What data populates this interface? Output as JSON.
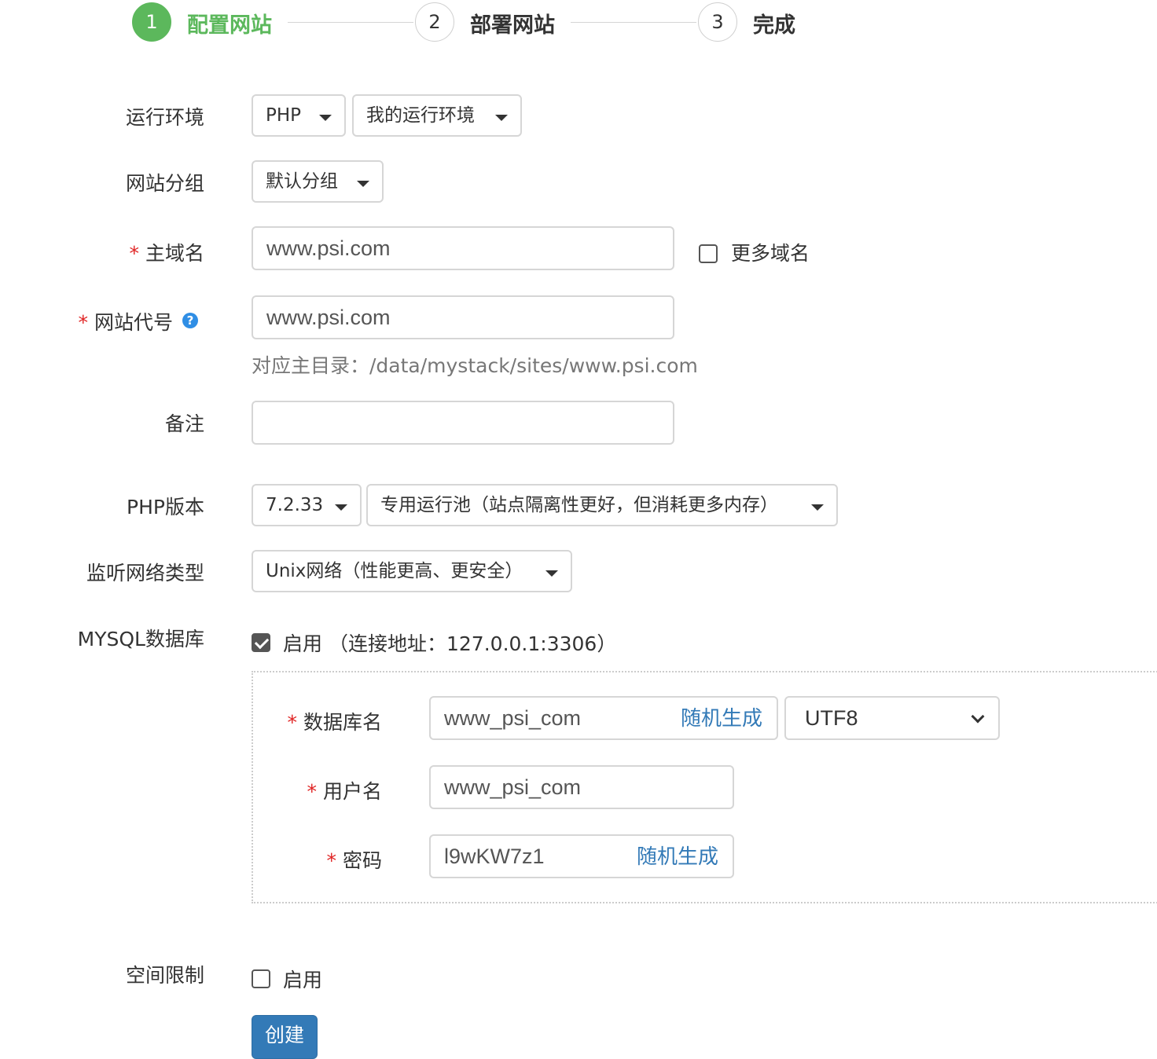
{
  "steps": [
    {
      "number": "1",
      "label": "配置网站",
      "active": true
    },
    {
      "number": "2",
      "label": "部署网站",
      "active": false
    },
    {
      "number": "3",
      "label": "完成",
      "active": false
    }
  ],
  "form": {
    "runtime": {
      "label": "运行环境",
      "type_value": "PHP",
      "env_value": "我的运行环境"
    },
    "group": {
      "label": "网站分组",
      "value": "默认分组"
    },
    "domain": {
      "required": "*",
      "label": "主域名",
      "value": "www.psi.com",
      "more_label": "更多域名",
      "more_checked": false
    },
    "site_code": {
      "required": "*",
      "label": "网站代号",
      "help_icon": "?",
      "value": "www.psi.com",
      "hint": "对应主目录：/data/mystack/sites/www.psi.com"
    },
    "remark": {
      "label": "备注",
      "value": ""
    },
    "php": {
      "label": "PHP版本",
      "version": "7.2.33",
      "pool": "专用运行池（站点隔离性更好，但消耗更多内存）"
    },
    "listen": {
      "label": "监听网络类型",
      "value": "Unix网络（性能更高、更安全）"
    },
    "mysql": {
      "label": "MYSQL数据库",
      "enabled_label": "启用",
      "enabled": true,
      "address": "（连接地址：127.0.0.1:3306）",
      "db_name": {
        "required": "*",
        "label": "数据库名",
        "value": "www_psi_com",
        "generate": "随机生成",
        "charset": "UTF8"
      },
      "username": {
        "required": "*",
        "label": "用户名",
        "value": "www_psi_com"
      },
      "password": {
        "required": "*",
        "label": "密码",
        "value": "l9wKW7z1",
        "generate": "随机生成"
      }
    },
    "quota": {
      "label": "空间限制",
      "enabled_label": "启用",
      "enabled": false
    },
    "submit": "创建"
  },
  "colors": {
    "active_step": "#5cb85c",
    "primary": "#337ab7",
    "link": "#337ab7",
    "required": "#e02424",
    "help": "#2f8ee5"
  }
}
